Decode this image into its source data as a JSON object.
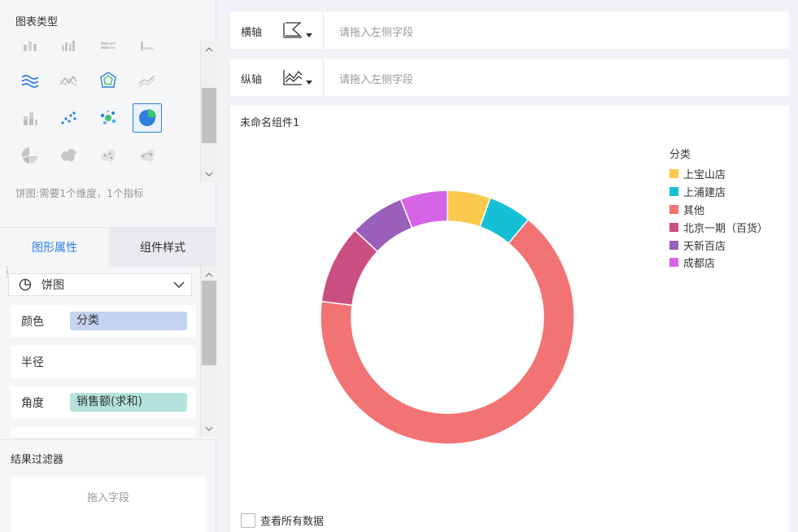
{
  "left_panel": {
    "chart_type_title": "图表类型",
    "hint": "饼图:需要1个维度，1个指标",
    "icons": [
      {
        "name": "stacked-bar-icon",
        "row": 0,
        "col": 0
      },
      {
        "name": "grouped-bar-icon",
        "row": 0,
        "col": 1
      },
      {
        "name": "horizontal-bar-icon",
        "row": 0,
        "col": 2
      },
      {
        "name": "horizontal-stacked-bar-icon",
        "row": 0,
        "col": 3
      },
      {
        "name": "multi-line-icon",
        "row": 1,
        "col": 0
      },
      {
        "name": "line-chart-icon",
        "row": 1,
        "col": 1
      },
      {
        "name": "radar-chart-icon",
        "row": 1,
        "col": 2
      },
      {
        "name": "area-line-icon",
        "row": 1,
        "col": 3
      },
      {
        "name": "stacked-column-icon",
        "row": 2,
        "col": 0
      },
      {
        "name": "scatter-chart-icon",
        "row": 2,
        "col": 1
      },
      {
        "name": "bubble-chart-icon",
        "row": 2,
        "col": 2
      },
      {
        "name": "pie-chart-icon",
        "row": 2,
        "col": 3,
        "selected": true
      },
      {
        "name": "rose-pie-icon",
        "row": 3,
        "col": 0
      },
      {
        "name": "china-map-icon",
        "row": 3,
        "col": 1
      },
      {
        "name": "scatter-map-icon",
        "row": 3,
        "col": 2
      },
      {
        "name": "flow-map-icon",
        "row": 3,
        "col": 3
      }
    ],
    "tabs": [
      "图形属性",
      "组件样式"
    ],
    "chart_kind": "饼图",
    "props": [
      {
        "label": "颜色",
        "chip": "分类",
        "chip_color": "#c3d3f0"
      },
      {
        "label": "半径",
        "chip": "",
        "chip_color": ""
      },
      {
        "label": "角度",
        "chip": "销售额(求和)",
        "chip_color": "#b4e3dc"
      }
    ],
    "filter_title": "结果过滤器",
    "filter_placeholder": "拖入字段"
  },
  "axes": {
    "x_label": "横轴",
    "y_label": "纵轴",
    "x_placeholder": "请拖入左侧字段",
    "y_placeholder": "请拖入左侧字段"
  },
  "chart_card": {
    "title": "未命名组件1",
    "view_all": "查看所有数据"
  },
  "chart_data": {
    "type": "pie",
    "title": "",
    "legend_title": "分类",
    "legend_position": "top-right",
    "slices": [
      {
        "label": "上宝山店",
        "value": 5.5,
        "color": "#fdc94d"
      },
      {
        "label": "上浦建店",
        "value": 5.5,
        "color": "#14c0d6"
      },
      {
        "label": "其他",
        "value": 66.0,
        "color": "#f27373"
      },
      {
        "label": "北京一期（百货）",
        "value": 10.0,
        "color": "#c94f80"
      },
      {
        "label": "天新百店",
        "value": 7.0,
        "color": "#9a5fba"
      },
      {
        "label": "成都店",
        "value": 6.0,
        "color": "#d564e6"
      }
    ]
  },
  "colors": {
    "accent": "#2f7fe0"
  }
}
